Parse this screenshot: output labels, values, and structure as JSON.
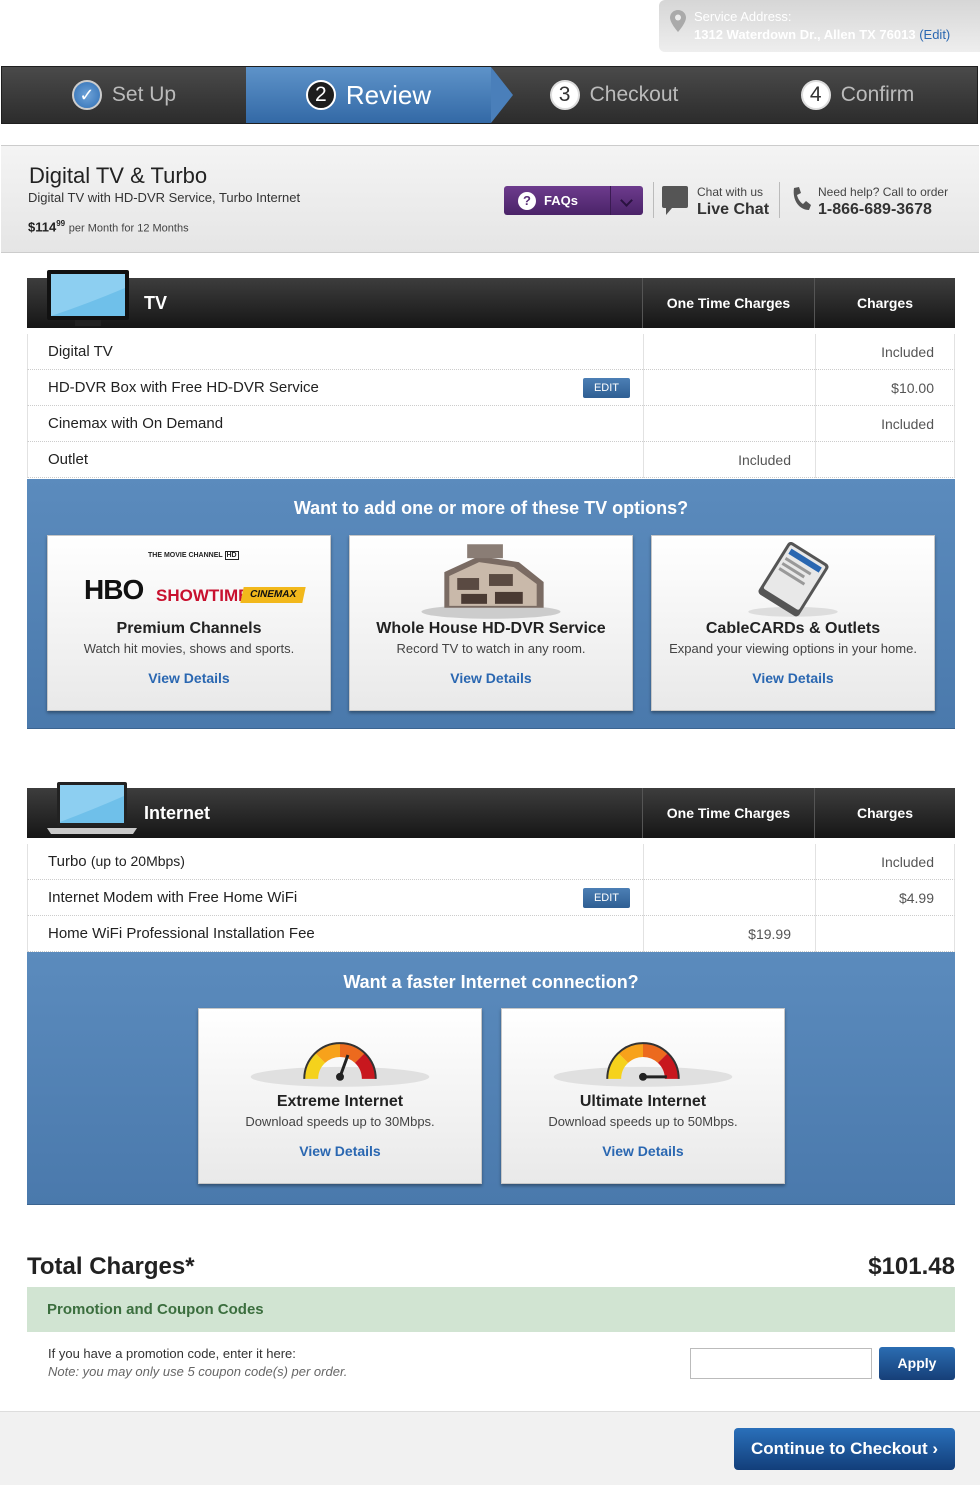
{
  "service": {
    "label": "Service Address:",
    "address": "1312 Waterdown Dr., Allen TX 76013",
    "edit": "(Edit)"
  },
  "steps": [
    {
      "num": "",
      "label": "Set Up"
    },
    {
      "num": "2",
      "label": "Review"
    },
    {
      "num": "3",
      "label": "Checkout"
    },
    {
      "num": "4",
      "label": "Confirm"
    }
  ],
  "plan": {
    "title": "Digital TV & Turbo",
    "subtitle": "Digital TV with HD-DVR Service, Turbo Internet",
    "price": "$114",
    "price_cents": "99",
    "price_term": "per Month for 12 Months"
  },
  "faq": {
    "label": "FAQs",
    "q": "?"
  },
  "chat": {
    "small": "Chat with us",
    "big": "Live Chat"
  },
  "call": {
    "small": "Need help? Call to order",
    "number": "1-866-689-3678"
  },
  "tv": {
    "title": "TV",
    "col1": "One Time Charges",
    "col2": "Charges",
    "rows": [
      {
        "item": "Digital TV",
        "one_time": "",
        "charge": "Included"
      },
      {
        "item": "HD-DVR Box with Free HD-DVR Service",
        "edit": "EDIT",
        "one_time": "",
        "charge": "$10.00"
      },
      {
        "item": "Cinemax with On Demand",
        "one_time": "",
        "charge": "Included"
      },
      {
        "item": "Outlet",
        "one_time": "Included",
        "charge": ""
      }
    ],
    "upsell": {
      "title": "Want to add one or more of these TV options?",
      "cards": [
        {
          "title": "Premium Channels",
          "desc": "Watch hit movies, shows and sports.",
          "link": "View Details",
          "logos": [
            "THE MOVIE CHANNEL",
            "HD",
            "HBO",
            "SHOWTIME",
            "CINEMAX"
          ]
        },
        {
          "title": "Whole House HD-DVR Service",
          "desc": "Record TV to watch in any room.",
          "link": "View Details"
        },
        {
          "title": "CableCARDs & Outlets",
          "desc": "Expand your viewing options in your home.",
          "link": "View Details"
        }
      ]
    }
  },
  "internet": {
    "title": "Internet",
    "col1": "One Time Charges",
    "col2": "Charges",
    "rows": [
      {
        "item": "Turbo",
        "item_note": "(up to 20Mbps)",
        "one_time": "",
        "charge": "Included"
      },
      {
        "item": "Internet Modem with Free Home WiFi",
        "edit": "EDIT",
        "one_time": "",
        "charge": "$4.99"
      },
      {
        "item": "Home WiFi Professional Installation Fee",
        "one_time": "$19.99",
        "charge": ""
      }
    ],
    "upsell": {
      "title": "Want a faster Internet connection?",
      "cards": [
        {
          "title": "Extreme Internet",
          "desc": "Download speeds up to 30Mbps.",
          "link": "View Details"
        },
        {
          "title": "Ultimate Internet",
          "desc": "Download speeds up to 50Mbps.",
          "link": "View Details"
        }
      ]
    }
  },
  "totals": {
    "label": "Total Charges*",
    "value": "$101.48"
  },
  "promo": {
    "header": "Promotion and Coupon Codes",
    "prompt": "If you have a promotion code, enter it here:",
    "note": "Note: you may only use 5 coupon code(s) per order.",
    "input_value": "",
    "apply": "Apply"
  },
  "continue": "Continue to Checkout ›",
  "colors": {
    "accent_blue": "#4a79ac",
    "faq_purple": "#5a2e78",
    "promo_green": "#d1e4d2",
    "link": "#2a67b1"
  }
}
